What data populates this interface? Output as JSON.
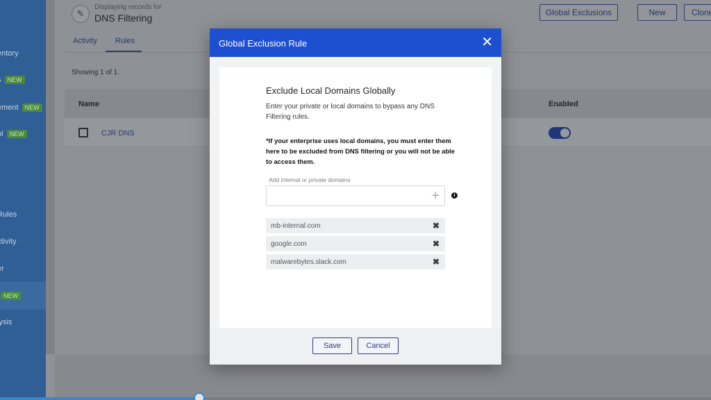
{
  "sidebar": {
    "items": [
      {
        "label": "entory",
        "badge": ""
      },
      {
        "label": "s",
        "badge": "NEW"
      },
      {
        "label": "ement",
        "badge": "NEW"
      },
      {
        "label": "ol",
        "badge": "NEW"
      },
      {
        "label": "Rules",
        "badge": ""
      },
      {
        "label": "ctivity",
        "badge": ""
      },
      {
        "label": "er",
        "badge": ""
      },
      {
        "label": "",
        "badge": "NEW"
      },
      {
        "label": "lysis",
        "badge": ""
      }
    ]
  },
  "header": {
    "displaying_label": "Displaying records for",
    "title": "DNS Filtering",
    "buttons": {
      "global_exclusions": "Global Exclusions",
      "new": "New",
      "clone": "Clone"
    }
  },
  "tabs": [
    {
      "label": "Activity",
      "active": false
    },
    {
      "label": "Rules",
      "active": true
    }
  ],
  "showing_text": "Showing 1 of 1.",
  "table": {
    "columns": [
      "Name",
      "Enabled"
    ],
    "rows": [
      {
        "name": "CJR DNS",
        "enabled": true
      }
    ]
  },
  "modal": {
    "title": "Global Exclusion Rule",
    "close_glyph": "✕",
    "heading": "Exclude Local Domains Globally",
    "description": "Enter your private or local domains to bypass any DNS Filtering rules.",
    "warning": "*If your enterprise uses local domains, you must enter them here to be excluded from DNS filtering or you will not be able to access them.",
    "input": {
      "label": "Add internal or private domains",
      "value": "",
      "add_glyph": "+"
    },
    "info_glyph": "i",
    "domains": [
      "mb-internal.com",
      "google.com",
      "malwarebytes.slack.com"
    ],
    "remove_glyph": "✖",
    "save_label": "Save",
    "cancel_label": "Cancel"
  },
  "video": {
    "progress_fraction": 0.28
  },
  "colors": {
    "sidebar": "#2f5f95",
    "modal_header": "#1d4fd1",
    "accent_text": "#283a86",
    "badge_new": "#4a8a3c",
    "progress": "#3b86c8"
  }
}
